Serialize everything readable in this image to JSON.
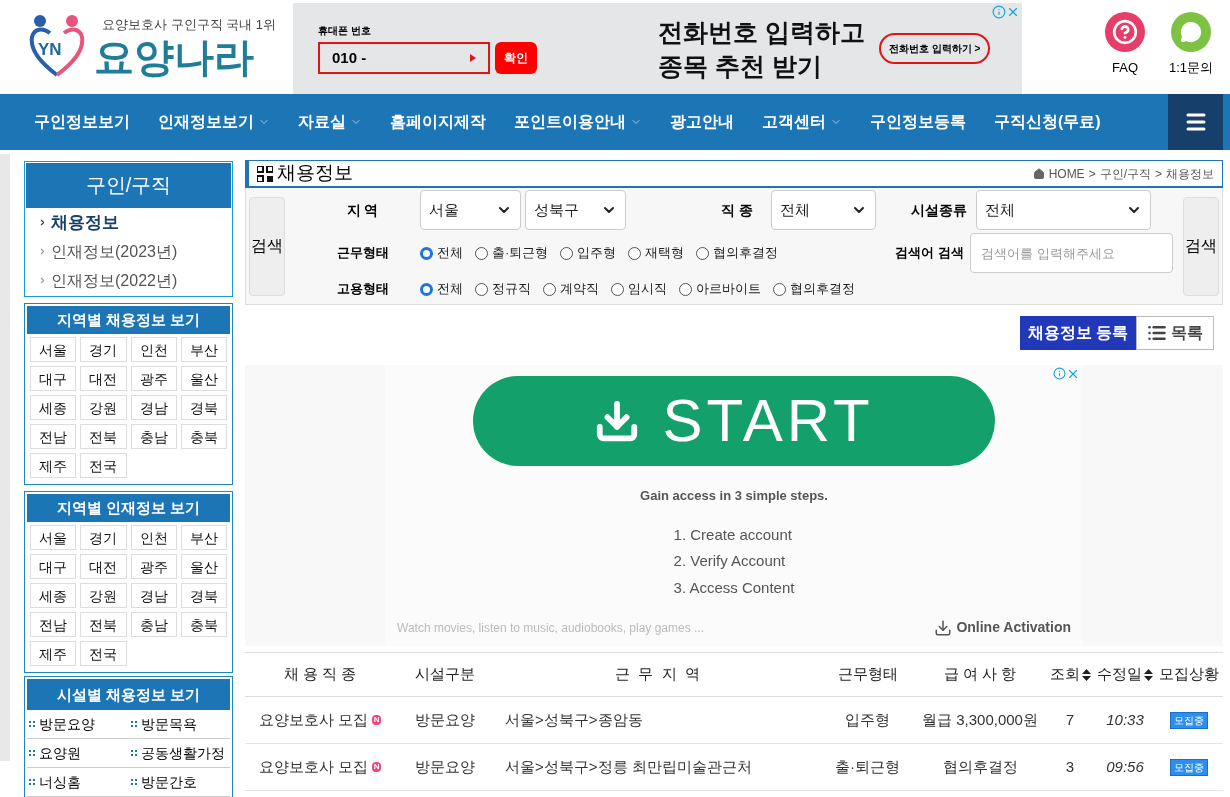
{
  "header": {
    "tagline": "요양보호사 구인구직 국내 1위",
    "logo_badge": "YN",
    "logo_text": "요양나라",
    "ad": {
      "field_label": "휴대폰 번호",
      "field_value": "010 -",
      "confirm": "확인",
      "headline": [
        "전화번호 입력하고",
        "종목 추천 받기"
      ],
      "cta": "전화번호 입력하기 >"
    },
    "quick_links": [
      {
        "kind": "faq",
        "label": "FAQ"
      },
      {
        "kind": "chat",
        "label": "1:1문의"
      }
    ]
  },
  "nav": {
    "items": [
      {
        "label": "구인정보보기",
        "has_dropdown": false
      },
      {
        "label": "인재정보보기",
        "has_dropdown": true
      },
      {
        "label": "자료실",
        "has_dropdown": true
      },
      {
        "label": "홈페이지제작",
        "has_dropdown": false
      },
      {
        "label": "포인트이용안내",
        "has_dropdown": true
      },
      {
        "label": "광고안내",
        "has_dropdown": false
      },
      {
        "label": "고객센터",
        "has_dropdown": true
      },
      {
        "label": "구인정보등록",
        "has_dropdown": false
      },
      {
        "label": "구직신청(무료)",
        "has_dropdown": false
      }
    ]
  },
  "sidebar": {
    "title": "구인/구직",
    "items": [
      {
        "label": "채용정보",
        "selected": true
      },
      {
        "label": "인재정보(2023년)",
        "selected": false
      },
      {
        "label": "인재정보(2022년)",
        "selected": false
      }
    ],
    "region_boxes": [
      {
        "title": "지역별 채용정보 보기",
        "regions": [
          "서울",
          "경기",
          "인천",
          "부산",
          "대구",
          "대전",
          "광주",
          "울산",
          "세종",
          "강원",
          "경남",
          "경북",
          "전남",
          "전북",
          "충남",
          "충북",
          "제주",
          "전국"
        ]
      },
      {
        "title": "지역별 인재정보 보기",
        "regions": [
          "서울",
          "경기",
          "인천",
          "부산",
          "대구",
          "대전",
          "광주",
          "울산",
          "세종",
          "강원",
          "경남",
          "경북",
          "전남",
          "전북",
          "충남",
          "충북",
          "제주",
          "전국"
        ]
      }
    ],
    "facility_box": {
      "title": "시설별 채용정보 보기",
      "items": [
        "방문요양",
        "방문목욕",
        "요양원",
        "공동생활가정",
        "너싱홈",
        "방문간호"
      ]
    }
  },
  "main": {
    "title": "채용정보",
    "breadcrumb": [
      "HOME",
      "구인/구직",
      "채용정보"
    ],
    "breadcrumb_separator": ">",
    "search": {
      "button_left": "검색",
      "button_right": "검색",
      "region_label": "지 역",
      "region_selects": [
        "서울",
        "성북구"
      ],
      "job_label": "직 종",
      "job_select": "전체",
      "facility_label": "시설종류",
      "facility_select": "전체",
      "keyword_label": "검색어 검색",
      "keyword_placeholder": "검색어를 입력해주세요",
      "work_type": {
        "label": "근무형태",
        "options": [
          {
            "label": "전체",
            "selected": true
          },
          {
            "label": "출·퇴근형",
            "selected": false
          },
          {
            "label": "입주형",
            "selected": false
          },
          {
            "label": "재택형",
            "selected": false
          },
          {
            "label": "협의후결정",
            "selected": false
          }
        ]
      },
      "employment": {
        "label": "고용형태",
        "options": [
          {
            "label": "전체",
            "selected": true
          },
          {
            "label": "정규직",
            "selected": false
          },
          {
            "label": "계약직",
            "selected": false
          },
          {
            "label": "임시직",
            "selected": false
          },
          {
            "label": "아르바이트",
            "selected": false
          },
          {
            "label": "협의후결정",
            "selected": false
          }
        ]
      }
    },
    "register_button": "채용정보 등록",
    "list_button": "목록",
    "ad": {
      "button": "START",
      "subtitle": "Gain access in 3 simple steps.",
      "steps": [
        "1. Create account",
        "2. Verify Account",
        "3. Access Content"
      ],
      "footer": "Watch movies, listen to music, audiobooks, play games ...",
      "activation": "Online Activation"
    },
    "table": {
      "columns": [
        {
          "label": "채 용 직 종",
          "sortable": false
        },
        {
          "label": "시설구분",
          "sortable": false
        },
        {
          "label": "근  무  지  역",
          "sortable": false
        },
        {
          "label": "근무형태",
          "sortable": false
        },
        {
          "label": "급 여 사 항",
          "sortable": false
        },
        {
          "label": "조회",
          "sortable": true
        },
        {
          "label": "수정일",
          "sortable": true
        },
        {
          "label": "모집상황",
          "sortable": false
        }
      ],
      "rows": [
        {
          "title": "요양보호사 모집",
          "new_badge": "N",
          "facility": "방문요양",
          "location": "서울>성북구>종암동",
          "work_type": "입주형",
          "salary": "월급 3,300,000원",
          "views": "7",
          "updated": "10:33",
          "status": "모집중"
        },
        {
          "title": "요양보호사 모집",
          "new_badge": "N",
          "facility": "방문요양",
          "location": "서울>성북구>정릉 최만립미술관근처",
          "work_type": "출·퇴근형",
          "salary": "협의후결정",
          "views": "3",
          "updated": "09:56",
          "status": "모집중"
        }
      ]
    }
  }
}
